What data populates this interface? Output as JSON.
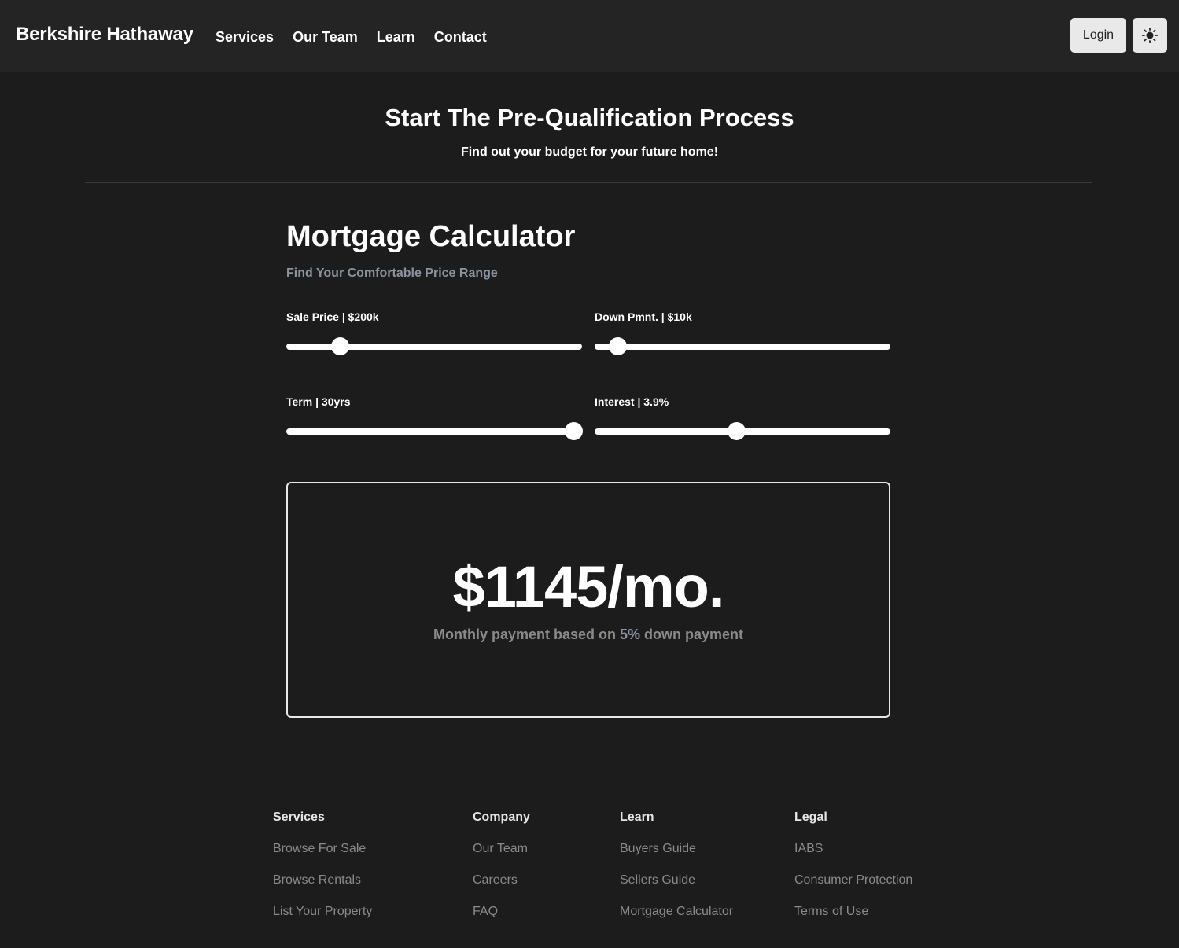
{
  "navbar": {
    "brand": "Berkshire Hathaway",
    "links": [
      "Services",
      "Our Team",
      "Learn",
      "Contact"
    ],
    "login_label": "Login",
    "theme_icon": "sun-icon"
  },
  "hero": {
    "title": "Start The Pre-Qualification Process",
    "subtitle": "Find out your budget for your future home!"
  },
  "calculator": {
    "title": "Mortgage Calculator",
    "subtitle": "Find Your Comfortable Price Range",
    "sliders": [
      {
        "label": "Sale Price | ",
        "value": "$200k",
        "fraction": 0.18
      },
      {
        "label": "Down Pmnt. | ",
        "value": "$10k",
        "fraction": 0.076
      },
      {
        "label": "Term | ",
        "value": "30yrs",
        "fraction": 0.97
      },
      {
        "label": "Interest | ",
        "value": "3.9%",
        "fraction": 0.48
      }
    ],
    "result": {
      "amount": "$1145/mo.",
      "note_prefix": "Monthly payment based on ",
      "note_percent": "5%",
      "note_suffix": " down payment"
    }
  },
  "footer": {
    "columns": [
      {
        "heading": "Services",
        "links": [
          "Browse For Sale",
          "Browse Rentals",
          "List Your Property"
        ]
      },
      {
        "heading": "Company",
        "links": [
          "Our Team",
          "Careers",
          "FAQ"
        ]
      },
      {
        "heading": "Learn",
        "links": [
          "Buyers Guide",
          "Sellers Guide",
          "Mortgage Calculator"
        ]
      },
      {
        "heading": "Legal",
        "links": [
          "IABS",
          "Consumer Protection",
          "Terms of Use"
        ]
      }
    ]
  },
  "colors": {
    "background": "#1c1c1d",
    "navbar": "#242424",
    "muted_text": "#8a8a8a",
    "accent_text": "#8a939e"
  }
}
